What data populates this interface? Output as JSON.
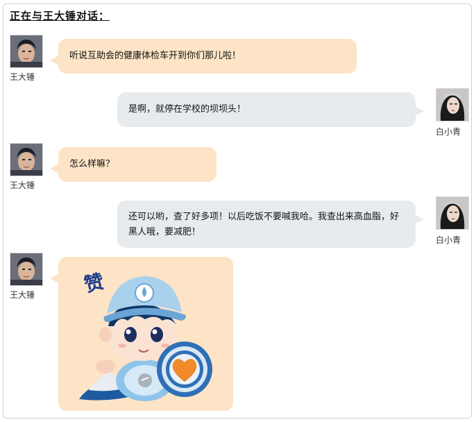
{
  "header": {
    "title": "正在与王大锤对话："
  },
  "messages": [
    {
      "sender": "王大锤",
      "side": "left",
      "text": "听说互助会的健康体检车开到你们那儿啦！"
    },
    {
      "sender": "白小青",
      "side": "right",
      "text": "是啊，就停在学校的坝坝头！"
    },
    {
      "sender": "王大锤",
      "side": "left",
      "text": "怎么样嘛？"
    },
    {
      "sender": "白小青",
      "side": "right",
      "text": "还可以哟，查了好多项！以后吃饭不要喊我哈。我查出来高血脂，好黑人哦，要减肥！"
    },
    {
      "sender": "王大锤",
      "side": "left",
      "sticker": {
        "name": "thumbs-up-mascot-sticker",
        "caption": "赞"
      }
    }
  ],
  "colors": {
    "left_bubble": "#fde4c6",
    "right_bubble": "#e8ebee",
    "sticker_cap": "#a9d1ec",
    "heart_orange": "#f08a2a"
  }
}
